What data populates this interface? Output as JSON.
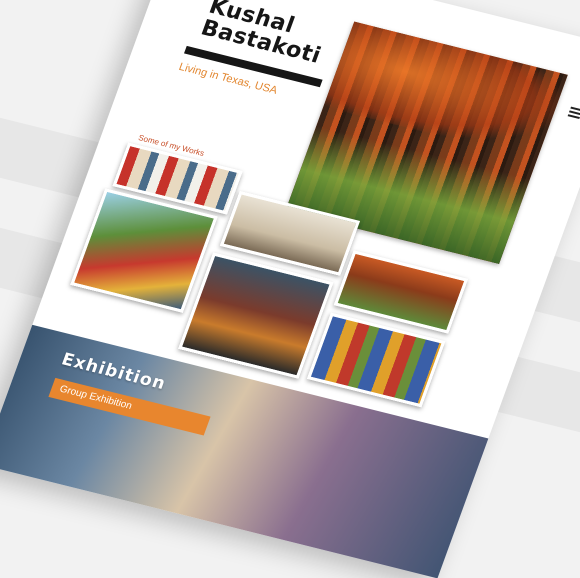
{
  "site": {
    "name_line1": "Kushal",
    "name_line2": "Bastakoti",
    "location": "Living in Texas, USA"
  },
  "works_section": {
    "label": "Some of my Works"
  },
  "exhibition": {
    "title": "Exhibition",
    "group_button": "Group Exhibition"
  },
  "icons": {
    "menu": "hamburger-menu-icon"
  },
  "colors": {
    "accent": "#e2862f",
    "text": "#161616",
    "button": "#e8862e"
  }
}
